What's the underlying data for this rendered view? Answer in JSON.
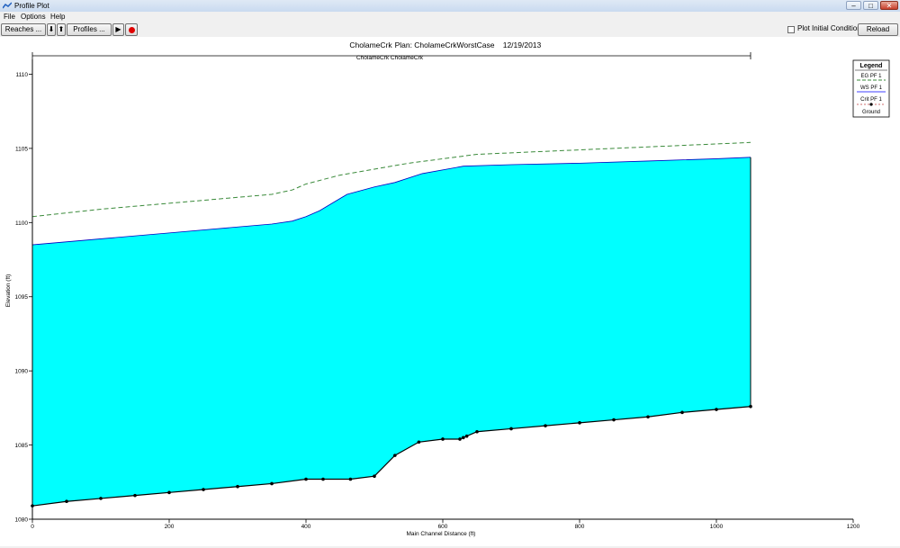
{
  "window": {
    "title": "Profile Plot"
  },
  "menu": [
    "File",
    "Options",
    "Help"
  ],
  "toolbar": {
    "reaches_label": "Reaches ...",
    "down_label": "⬇",
    "up_label": "⬆",
    "profiles_label": "Profiles ...",
    "play_label": "▶",
    "stop_color": "#e00000",
    "plot_initial_label": "Plot Initial Conditions",
    "plot_initial_checked": false,
    "reload_label": "Reload Data"
  },
  "chart_data": {
    "type": "area",
    "title_parts": [
      "CholameCrk",
      "Plan: CholameCrkWorstCase",
      "12/19/2013"
    ],
    "reach_label": "CholameCrk CholameCrk",
    "xlabel": "Main Channel Distance (ft)",
    "ylabel": "Elevation (ft)",
    "xlim": [
      0,
      1200
    ],
    "ylim": [
      1080,
      1111
    ],
    "xticks": [
      "0",
      "200",
      "400",
      "600",
      "800",
      "1000",
      "1200"
    ],
    "yticks": [
      "1080",
      "1085",
      "1090",
      "1095",
      "1100",
      "1105",
      "1110"
    ],
    "legend": {
      "title": "Legend",
      "entries": [
        "EG  PF 1",
        "WS  PF 1",
        "Crit  PF 1",
        "Ground"
      ],
      "position": "top-right"
    },
    "colors": {
      "ws_fill": "#00ffff",
      "eg": "#3a8a3a",
      "ground": "#000000"
    },
    "series": [
      {
        "name": "EG  PF 1",
        "x": [
          0,
          100,
          200,
          300,
          350,
          380,
          400,
          450,
          500,
          550,
          600,
          650,
          700,
          800,
          900,
          1000,
          1050
        ],
        "y": [
          1100.4,
          1100.9,
          1101.3,
          1101.7,
          1101.9,
          1102.2,
          1102.6,
          1103.2,
          1103.6,
          1104.0,
          1104.3,
          1104.6,
          1104.7,
          1104.9,
          1105.1,
          1105.3,
          1105.4
        ]
      },
      {
        "name": "WS  PF 1",
        "x": [
          0,
          100,
          200,
          300,
          350,
          380,
          400,
          420,
          460,
          500,
          530,
          570,
          630,
          700,
          800,
          900,
          1000,
          1050
        ],
        "y": [
          1098.5,
          1098.9,
          1099.3,
          1099.7,
          1099.9,
          1100.1,
          1100.4,
          1100.8,
          1101.9,
          1102.4,
          1102.7,
          1103.3,
          1103.8,
          1103.9,
          1104.0,
          1104.15,
          1104.3,
          1104.4
        ]
      },
      {
        "name": "Ground",
        "x": [
          0,
          50,
          100,
          150,
          200,
          250,
          300,
          350,
          400,
          425,
          465,
          500,
          530,
          565,
          600,
          625,
          630,
          635,
          650,
          700,
          750,
          800,
          850,
          900,
          950,
          1000,
          1050
        ],
        "y": [
          1080.9,
          1081.2,
          1081.4,
          1081.6,
          1081.8,
          1082.0,
          1082.2,
          1082.4,
          1082.7,
          1082.7,
          1082.7,
          1082.9,
          1084.3,
          1085.2,
          1085.4,
          1085.4,
          1085.5,
          1085.6,
          1085.9,
          1086.1,
          1086.3,
          1086.5,
          1086.7,
          1086.9,
          1087.2,
          1087.4,
          1087.6
        ]
      }
    ]
  }
}
